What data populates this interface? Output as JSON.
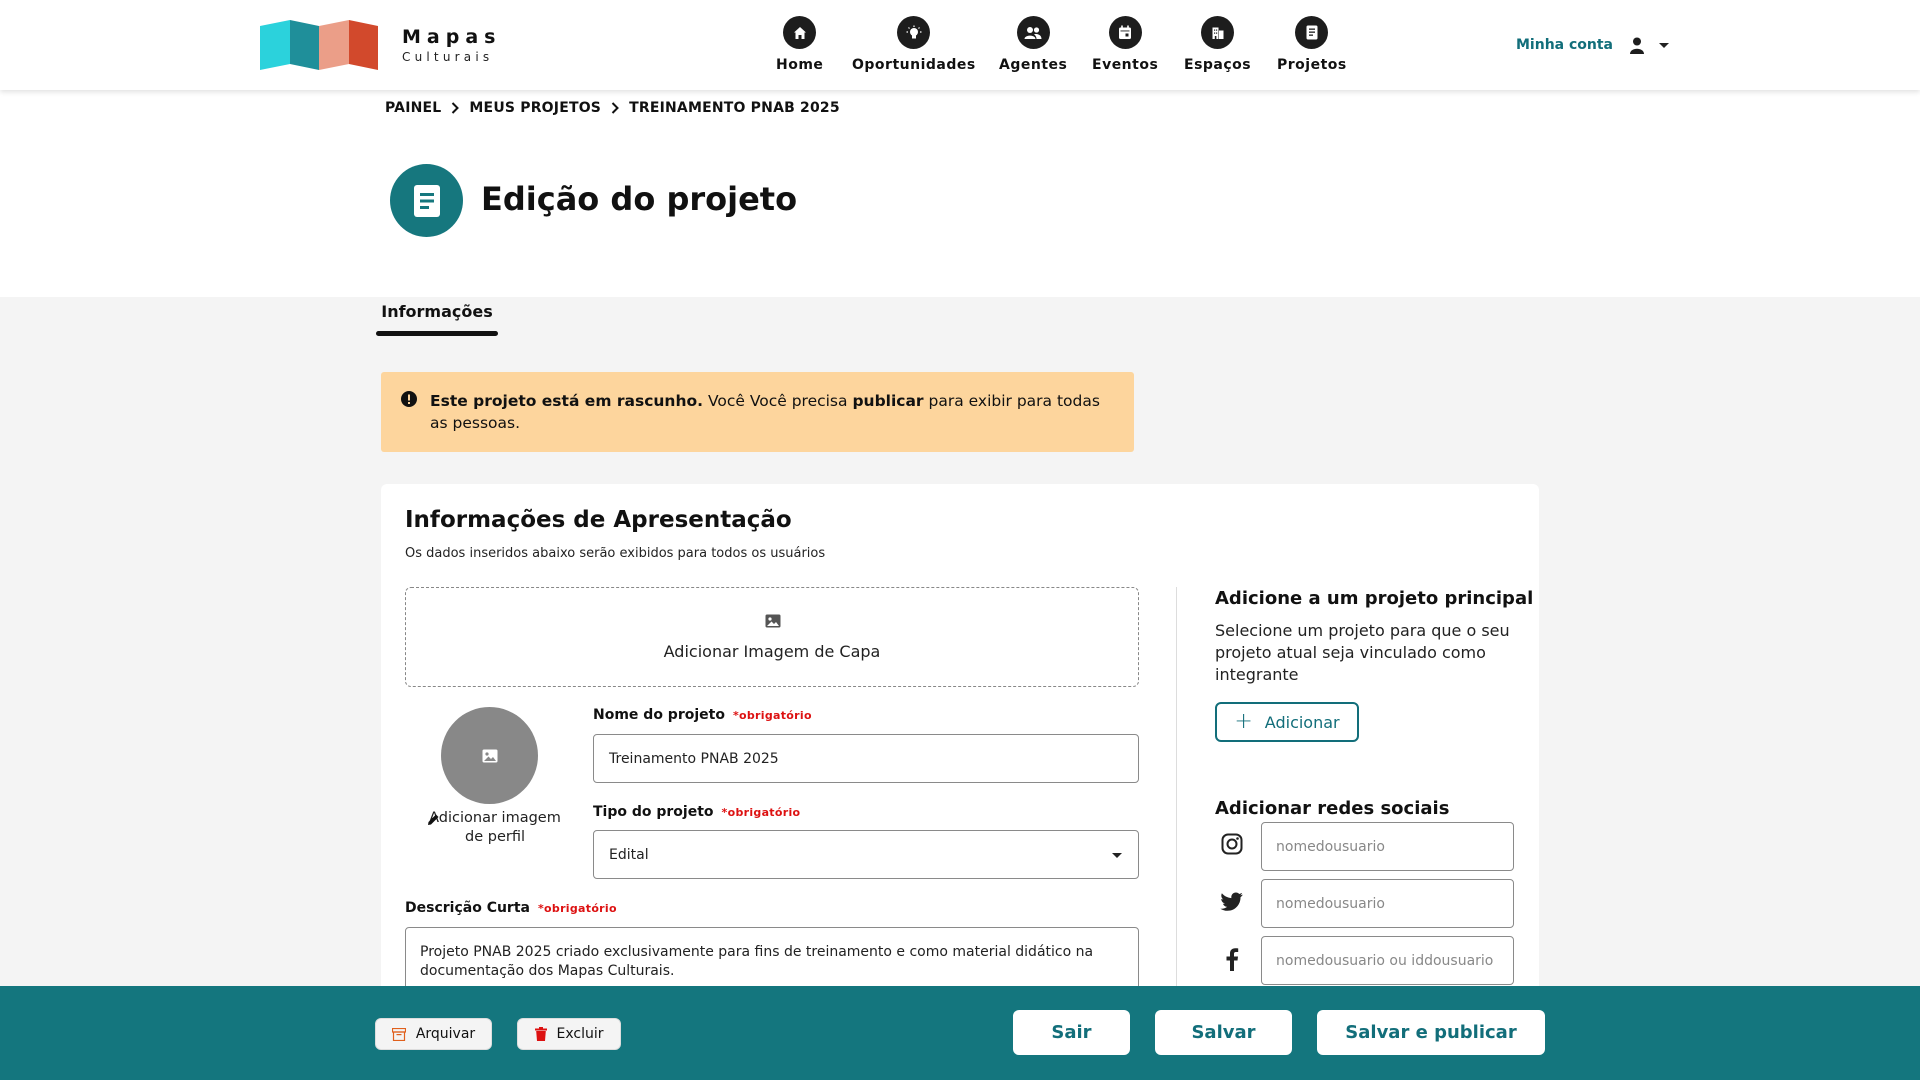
{
  "brand": {
    "title": "Mapas",
    "subtitle": "Culturais"
  },
  "nav": [
    {
      "label": "Home",
      "icon": "home-icon"
    },
    {
      "label": "Oportunidades",
      "icon": "lightbulb-icon"
    },
    {
      "label": "Agentes",
      "icon": "people-icon"
    },
    {
      "label": "Eventos",
      "icon": "calendar-icon"
    },
    {
      "label": "Espaços",
      "icon": "building-icon"
    },
    {
      "label": "Projetos",
      "icon": "document-icon"
    }
  ],
  "account": {
    "label": "Minha conta"
  },
  "breadcrumb": [
    "PAINEL",
    "MEUS PROJETOS",
    "TREINAMENTO PNAB 2025"
  ],
  "page_title": "Edição do projeto",
  "tabs": [
    {
      "label": "Informações",
      "active": true
    }
  ],
  "alert": {
    "strong": "Este projeto está em rascunho.",
    "text1": " Você Você precisa ",
    "strong2": "publicar",
    "text2": " para exibir para todas as pessoas."
  },
  "section": {
    "title": "Informações de Apresentação",
    "subtitle": "Os dados inseridos abaixo serão exibidos para todos os usuários",
    "cover_label": "Adicionar Imagem de Capa",
    "avatar_label": "Adicionar imagem de perfil",
    "required": "*obrigatório",
    "name_label": "Nome do projeto",
    "name_value": "Treinamento PNAB 2025",
    "type_label": "Tipo do projeto",
    "type_value": "Edital",
    "desc_label": "Descrição Curta",
    "desc_value": "Projeto PNAB 2025 criado exclusivamente para fins de treinamento e como material didático na documentação dos Mapas Culturais."
  },
  "side": {
    "parent_title": "Adicione a um projeto principal",
    "parent_text": "Selecione um projeto para que o seu projeto atual seja vinculado como integrante",
    "add_button": "Adicionar",
    "social_title": "Adicionar redes sociais",
    "social": [
      {
        "network": "instagram-icon",
        "placeholder": "nomedousuario"
      },
      {
        "network": "twitter-icon",
        "placeholder": "nomedousuario"
      },
      {
        "network": "facebook-icon",
        "placeholder": "nomedousuario ou iddousuario"
      }
    ]
  },
  "footer": {
    "archive": "Arquivar",
    "delete": "Excluir",
    "exit": "Sair",
    "save": "Salvar",
    "save_publish": "Salvar e publicar"
  },
  "colors": {
    "primary": "#126e7a",
    "footer": "#14767e",
    "alert_bg": "#fdd59d",
    "required": "#dd1111"
  }
}
